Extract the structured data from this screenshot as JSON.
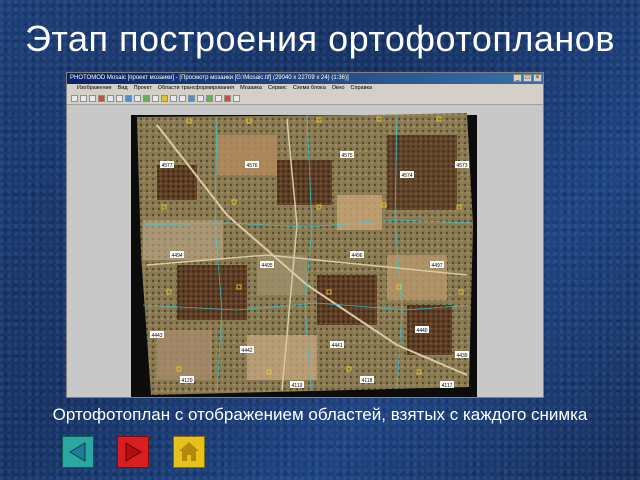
{
  "slide": {
    "title": "Этап построения ортофотопланов",
    "caption": "Ортофотоплан с отображением областей, взятых с каждого снимка"
  },
  "window": {
    "title": "PHOTOMOD Mosaic [проект мозаики] - [Просмотр мозаики [G:\\Mosaic.tif] (29040 x 22709 x 24) (1:36)]",
    "menu": [
      "Изображение",
      "Вид",
      "Проект",
      "Области трансформирования",
      "Мозаика",
      "Сервис",
      "Схема блока",
      "Окно",
      "Справка"
    ]
  },
  "mosaic_labels": [
    "4577",
    "4576",
    "4575",
    "4574",
    "4573",
    "4494",
    "4495",
    "4496",
    "4497",
    "4443",
    "4442",
    "4441",
    "4440",
    "4439",
    "4120",
    "4119",
    "4118",
    "4117"
  ],
  "nav": {
    "back_icon": "triangle-left-icon",
    "forward_icon": "triangle-right-icon",
    "home_icon": "house-icon",
    "colors": {
      "back": "#2aa7a0",
      "forward": "#d81e1e",
      "home": "#e8c21a"
    }
  }
}
